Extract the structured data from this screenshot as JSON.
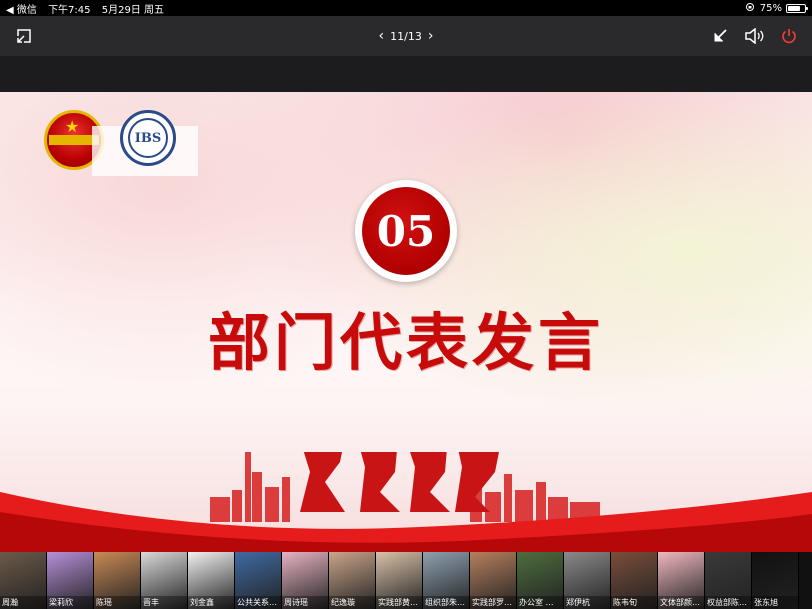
{
  "statusbar": {
    "back_app": "◀ 微信",
    "time": "下午7:45",
    "date": "5月29日 周五",
    "battery_text": "75%",
    "battery_level": 0.75
  },
  "toolbar": {
    "page_indicator": "11/13"
  },
  "slide": {
    "number": "05",
    "title": "部门代表发言",
    "logo2_text": "IBS"
  },
  "participants": [
    {
      "name": "周瀚",
      "color": "#6b5a4a"
    },
    {
      "name": "梁莉欣",
      "color": "#b68fd9"
    },
    {
      "name": "陈瑶",
      "color": "#c98a55"
    },
    {
      "name": "晋丰",
      "color": "#d9d9d9"
    },
    {
      "name": "刘金鑫",
      "color": "#f2f2f2"
    },
    {
      "name": "公共关系…",
      "color": "#3f6aa3"
    },
    {
      "name": "周诗瑶",
      "color": "#e8b3c3"
    },
    {
      "name": "纪逸璇",
      "color": "#caa58a"
    },
    {
      "name": "实践部黄…",
      "color": "#d8c1a8"
    },
    {
      "name": "组织部朱…",
      "color": "#8fa0b0"
    },
    {
      "name": "实践部罗…",
      "color": "#b6805e"
    },
    {
      "name": "办公室 潘叡",
      "color": "#4e6e3e"
    },
    {
      "name": "郑伊杭",
      "color": "#8a8a8a"
    },
    {
      "name": "陈韦旬",
      "color": "#7a4e3a"
    },
    {
      "name": "文体部颜…",
      "color": "#f0b8c0"
    },
    {
      "name": "权益部陈…",
      "color": "#3a3a3a"
    },
    {
      "name": "张东旭",
      "color": "#111111"
    }
  ]
}
